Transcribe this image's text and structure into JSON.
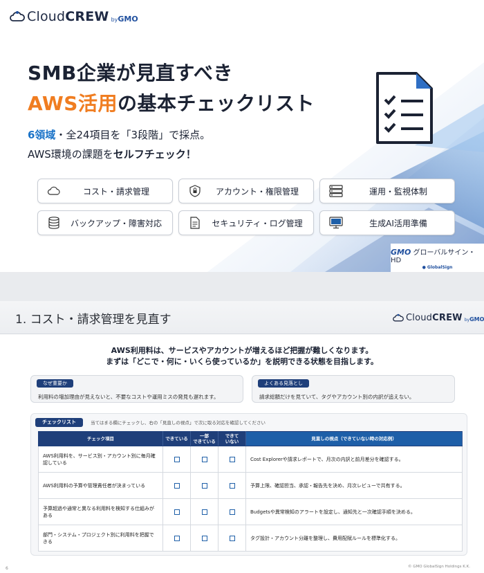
{
  "brand": {
    "name_prefix": "Cloud",
    "name_bold": "CREW",
    "by": "by",
    "gmo": "GMO"
  },
  "slide1": {
    "title_line1": "SMB企業が見直すべき",
    "title_line2_highlight": "AWS活用",
    "title_line2_rest": "の基本チェックリスト",
    "sub1_blue": "6領域",
    "sub1_rest": "・全24項目を「3段階」で採点。",
    "sub2_pre": "AWS環境の課題を",
    "sub2_bold": "セルフチェック！",
    "chips": [
      {
        "label": "コスト・請求管理",
        "icon": "cloud-icon"
      },
      {
        "label": "アカウント・権限管理",
        "icon": "shield-lock-icon"
      },
      {
        "label": "運用・監視体制",
        "icon": "server-icon"
      },
      {
        "label": "バックアップ・障害対応",
        "icon": "database-icon"
      },
      {
        "label": "セキュリティ・ログ管理",
        "icon": "document-icon"
      },
      {
        "label": "生成AI活用準備",
        "icon": "monitor-icon"
      }
    ],
    "badge_gmo": "GMO",
    "badge_line1": "グローバルサイン・HD",
    "badge_line2": "● GlobalSign",
    "colors": {
      "accent_orange": "#f07d21",
      "accent_blue": "#1a73c8",
      "navy": "#1f3f7a"
    }
  },
  "slide2": {
    "title": "1. コスト・請求管理を見直す",
    "lead_line1": "AWS利用料は、サービスやアカウントが増えるほど把握が難しくなります。",
    "lead_line2": "まずは「どこで・何に・いくら使っているか」を説明できる状態を目指します。",
    "why_tag": "なぜ重要か",
    "why_text": "利用料の増加理由が見えないと、不要なコストや運用ミスの発見も遅れます。",
    "pitfall_tag": "よくある見落とし",
    "pitfall_text": "請求総額だけを見ていて、タグやアカウント別の内訳が追えない。",
    "checklist_tag": "チェックリスト",
    "checklist_note": "当てはまる欄にチェックし、右の「見直しの視点」で次に取る対応を確認してください",
    "table": {
      "headers": {
        "item": "チェック項目",
        "done": "できている",
        "partial_l1": "一部",
        "partial_l2": "できている",
        "notdone_l1": "できて",
        "notdone_l2": "いない",
        "perspective": "見直しの視点（できていない時の対応例）"
      },
      "rows": [
        {
          "item": "AWS利用料を、サービス別・アカウント別に毎月確認している",
          "perspective": "Cost Explorerや請求レポートで、月次の内訳と前月差分を確認する。"
        },
        {
          "item": "AWS利用料の予算や管理責任者が決まっている",
          "perspective": "予算上限、確認担当、承認・報告先を決め、月次レビューで共有する。"
        },
        {
          "item": "予算超過や通常と異なる利用料を検知する仕組みがある",
          "perspective": "Budgetsや異常検知のアラートを設定し、通知先と一次確認手順を決める。"
        },
        {
          "item": "部門・システム・プロジェクト別に利用料を把握できる",
          "perspective": "タグ設計・アカウント分離を整理し、費用配賦ルールを標準化する。"
        }
      ]
    },
    "page_number": "6",
    "copyright": "© GMO GlobalSign Holdings K.K."
  }
}
